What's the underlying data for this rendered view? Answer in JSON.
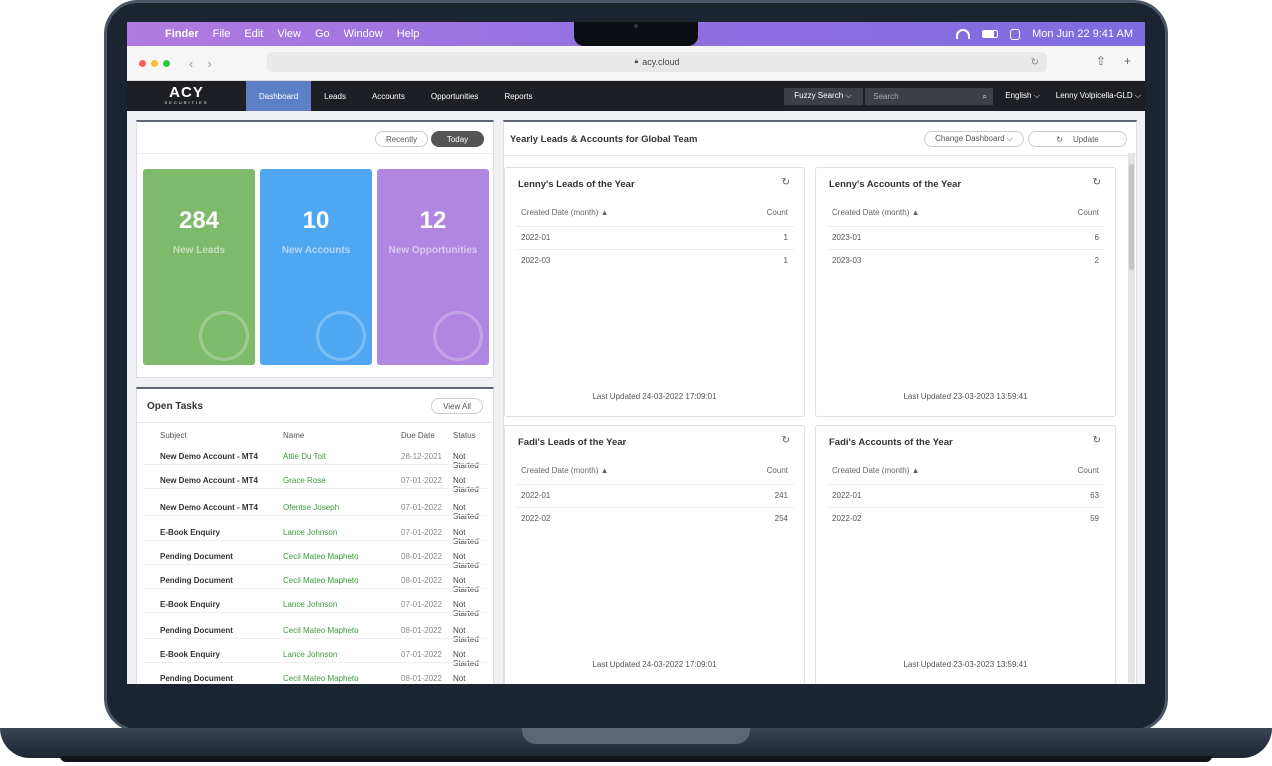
{
  "menubar": {
    "app": "Finder",
    "items": [
      "File",
      "Edit",
      "View",
      "Go",
      "Window",
      "Help"
    ],
    "clock": "Mon Jun 22  9:41 AM"
  },
  "browser": {
    "url": "acy.cloud"
  },
  "brand": {
    "line1": "ACY",
    "line2": "SECURITIES"
  },
  "nav": {
    "items": [
      "Dashboard",
      "Leads",
      "Accounts",
      "Opportunities",
      "Reports"
    ],
    "active": "Dashboard",
    "fuzzy_label": "Fuzzy Search ⌵",
    "search_placeholder": "Search",
    "language": "English ⌵",
    "user": "Lenny Volpicella-GLD ⌵"
  },
  "stats": {
    "toggle_recently": "Recently",
    "toggle_today": "Today",
    "tiles": [
      {
        "value": "284",
        "label": "New Leads",
        "color": "#7dba6c"
      },
      {
        "value": "10",
        "label": "New Accounts",
        "color": "#4fa7f2"
      },
      {
        "value": "12",
        "label": "New Opportunities",
        "color": "#b086e0"
      }
    ]
  },
  "tasks": {
    "title": "Open Tasks",
    "view_all": "View All",
    "columns": [
      "Subject",
      "Name",
      "Due Date",
      "Status"
    ],
    "rows": [
      {
        "subject": "New Demo Account - MT4",
        "name": "Attie Du Toit",
        "due": "28-12-2021",
        "status": "Not Started"
      },
      {
        "subject": "New Demo Account - MT4",
        "name": "Grace Rose",
        "due": "07-01-2022",
        "status": "Not Started"
      },
      {
        "subject": "New Demo Account - MT4",
        "name": "Ofentse Joseph",
        "due": "07-01-2022",
        "status": "Not Started"
      },
      {
        "subject": "E-Book Enquiry",
        "name": "Lance Johnson",
        "due": "07-01-2022",
        "status": "Not Started"
      },
      {
        "subject": "Pending Document",
        "name": "Cecil Mateo Mapheto",
        "due": "08-01-2022",
        "status": "Not Started"
      },
      {
        "subject": "Pending Document",
        "name": "Cecil Mateo Mapheto",
        "due": "08-01-2022",
        "status": "Not Started"
      },
      {
        "subject": "E-Book Enquiry",
        "name": "Lance Johnson",
        "due": "07-01-2022",
        "status": "Not Started"
      },
      {
        "subject": "Pending Document",
        "name": "Cecil Mateo Mapheto",
        "due": "08-01-2022",
        "status": "Not Started"
      },
      {
        "subject": "E-Book Enquiry",
        "name": "Lance Johnson",
        "due": "07-01-2022",
        "status": "Not Started"
      },
      {
        "subject": "Pending Document",
        "name": "Cecil Mateo Mapheto",
        "due": "08-01-2022",
        "status": "Not Started"
      }
    ]
  },
  "dashboard": {
    "title": "Yearly Leads & Accounts for Global Team",
    "change_label": "Change Dashboard ⌵",
    "update_label": "Update",
    "cards": [
      {
        "title": "Lenny's Leads of the Year",
        "col1": "Created Date (month) ▲",
        "col2": "Count",
        "rows": [
          {
            "k": "2022-01",
            "v": "1"
          },
          {
            "k": "2022-03",
            "v": "1"
          }
        ],
        "footer": "Last Updated 24-03-2022 17:09:01"
      },
      {
        "title": "Lenny's Accounts of the Year",
        "col1": "Created Date (month) ▲",
        "col2": "Count",
        "rows": [
          {
            "k": "2023-01",
            "v": "6"
          },
          {
            "k": "2023-03",
            "v": "2"
          }
        ],
        "footer": "Last Updated 23-03-2023 13:59:41"
      },
      {
        "title": "Fadi's Leads of the Year",
        "col1": "Created Date (month) ▲",
        "col2": "Count",
        "rows": [
          {
            "k": "2022-01",
            "v": "241"
          },
          {
            "k": "2022-02",
            "v": "254"
          }
        ],
        "footer": "Last Updated 24-03-2022 17:09:01"
      },
      {
        "title": "Fadi's Accounts of the Year",
        "col1": "Created Date (month) ▲",
        "col2": "Count",
        "rows": [
          {
            "k": "2022-01",
            "v": "63"
          },
          {
            "k": "2022-02",
            "v": "59"
          }
        ],
        "footer": "Last Updated 23-03-2023 13:59:41"
      }
    ]
  }
}
